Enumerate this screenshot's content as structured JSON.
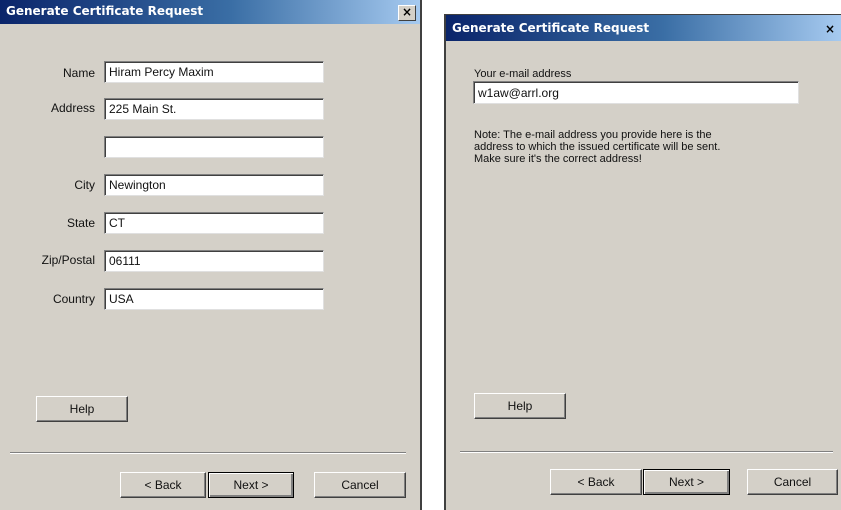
{
  "left_dialog": {
    "title": "Generate Certificate Request",
    "close_glyph": "×",
    "fields": [
      {
        "label": "Name",
        "value": "Hiram Percy Maxim"
      },
      {
        "label": "Address",
        "value": "225 Main St."
      },
      {
        "label": "",
        "value": ""
      },
      {
        "label": "City",
        "value": "Newington"
      },
      {
        "label": "State",
        "value": "CT"
      },
      {
        "label": "Zip/Postal",
        "value": "06111"
      },
      {
        "label": "Country",
        "value": "USA"
      }
    ],
    "help_label": "Help",
    "back_label": "< Back",
    "next_label": "Next >",
    "cancel_label": "Cancel"
  },
  "right_dialog": {
    "title": "Generate Certificate Request",
    "close_glyph": "×",
    "email_label": "Your e-mail address",
    "email_value": "w1aw@arrl.org",
    "note_lines": [
      "Note: The e-mail address you provide here is the",
      "address to which the issued certificate will be sent.",
      "Make sure it's the correct address!"
    ],
    "help_label": "Help",
    "back_label": "< Back",
    "next_label": "Next >",
    "cancel_label": "Cancel"
  },
  "icons": {
    "close": "close-icon"
  }
}
